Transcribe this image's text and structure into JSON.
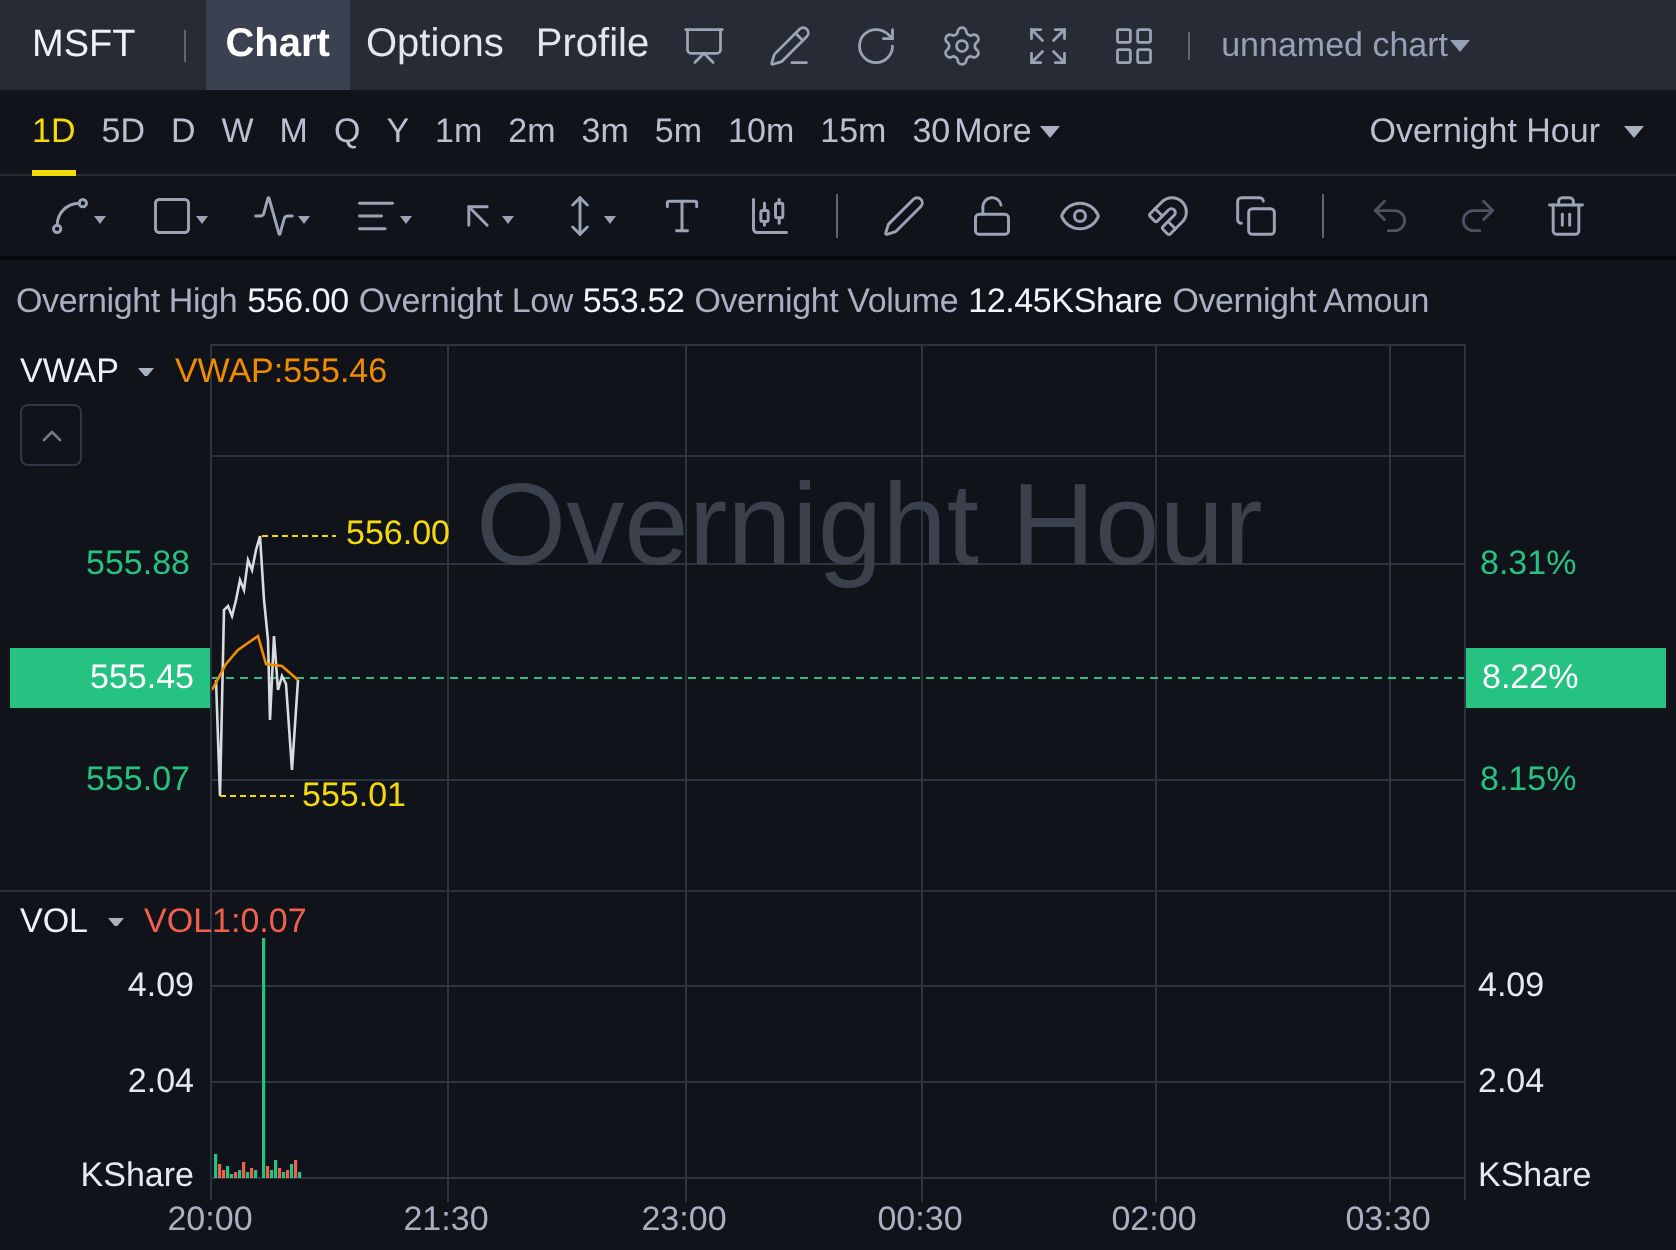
{
  "header": {
    "symbol": "MSFT",
    "tabs": [
      {
        "label": "Chart",
        "selected": true
      },
      {
        "label": "Options",
        "selected": false
      },
      {
        "label": "Profile",
        "selected": false
      }
    ],
    "layout_name": "unnamed chart"
  },
  "periods": {
    "items": [
      {
        "label": "1D",
        "selected": true
      },
      {
        "label": "5D",
        "selected": false
      },
      {
        "label": "D",
        "selected": false
      },
      {
        "label": "W",
        "selected": false
      },
      {
        "label": "M",
        "selected": false
      },
      {
        "label": "Q",
        "selected": false
      },
      {
        "label": "Y",
        "selected": false
      },
      {
        "label": "1m",
        "selected": false
      },
      {
        "label": "2m",
        "selected": false
      },
      {
        "label": "3m",
        "selected": false
      },
      {
        "label": "5m",
        "selected": false
      },
      {
        "label": "10m",
        "selected": false
      },
      {
        "label": "15m",
        "selected": false
      },
      {
        "label": "30",
        "selected": false
      }
    ],
    "more": "More",
    "session": "Overnight Hour"
  },
  "drawing_toolbar": {
    "undo": {
      "disabled": true
    },
    "redo": {
      "disabled": true
    }
  },
  "summary": [
    {
      "label": "Overnight High",
      "value": "556.00"
    },
    {
      "label": "Overnight Low",
      "value": "553.52"
    },
    {
      "label": "Overnight Volume",
      "value": "12.45KShare"
    },
    {
      "label": "Overnight Amoun"
    }
  ],
  "price_pane": {
    "indicator": "VWAP",
    "indicator_reading": "VWAP:555.46",
    "watermark": "Overnight Hour",
    "high_label": "556.00",
    "low_label": "555.01",
    "left_axis": [
      "555.88",
      "555.07"
    ],
    "right_axis": [
      "8.31%",
      "8.15%"
    ],
    "current_price": "555.45",
    "current_change": "8.22%"
  },
  "volume_pane": {
    "indicator": "VOL",
    "indicator_reading": "VOL1:0.07",
    "left_axis": [
      "4.09",
      "2.04",
      "KShare"
    ],
    "right_axis": [
      "4.09",
      "2.04",
      "KShare"
    ]
  },
  "time_axis": [
    "20:00",
    "21:30",
    "23:00",
    "00:30",
    "02:00",
    "03:30"
  ]
}
